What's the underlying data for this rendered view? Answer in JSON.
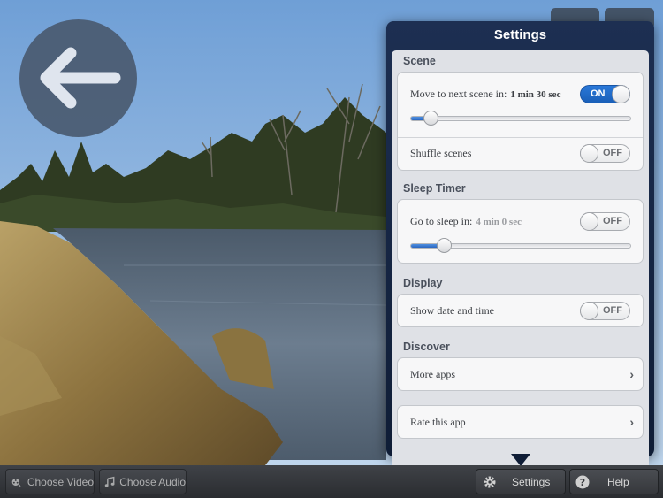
{
  "back_button": {
    "icon": "left-arrow-icon"
  },
  "settings_popover": {
    "title": "Settings",
    "scene": {
      "header": "Scene",
      "next_scene_label": "Move to next scene in:",
      "next_scene_value": "1 min 30 sec",
      "next_scene_toggle": "ON",
      "next_scene_slider_fraction": 0.09,
      "shuffle_label": "Shuffle scenes",
      "shuffle_toggle": "OFF"
    },
    "sleep_timer": {
      "header": "Sleep Timer",
      "sleep_label": "Go to sleep in:",
      "sleep_value": "4 min 0 sec",
      "sleep_toggle": "OFF",
      "sleep_slider_fraction": 0.15
    },
    "display": {
      "header": "Display",
      "date_time_label": "Show date and time",
      "date_time_toggle": "OFF"
    },
    "discover": {
      "header": "Discover",
      "more_apps_label": "More apps",
      "rate_app_label": "Rate this app"
    }
  },
  "toolbar": {
    "choose_video_label": "Choose Video",
    "choose_audio_label": "Choose Audio",
    "settings_label": "Settings",
    "help_label": "Help",
    "icons": [
      "film-reel-icon",
      "music-note-icon",
      "gear-icon",
      "help-icon"
    ]
  }
}
